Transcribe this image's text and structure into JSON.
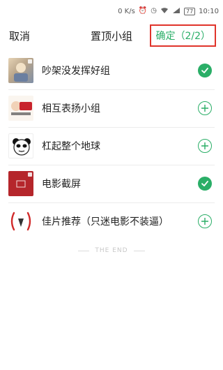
{
  "status_bar": {
    "network_speed": "0 K/s",
    "battery": "77",
    "time": "10:10"
  },
  "header": {
    "cancel_label": "取消",
    "title": "置顶小组",
    "confirm_label": "确定（2/2）"
  },
  "groups": [
    {
      "name": "吵架没发挥好组",
      "selected": true
    },
    {
      "name": "相互表扬小组",
      "selected": false
    },
    {
      "name": "杠起整个地球",
      "selected": false
    },
    {
      "name": "电影截屏",
      "selected": true
    },
    {
      "name": "佳片推荐（只迷电影不装逼）",
      "selected": false
    }
  ],
  "footer": {
    "end_text": "THE END"
  },
  "colors": {
    "accent_green": "#2aae67",
    "highlight_red": "#e0342b"
  }
}
